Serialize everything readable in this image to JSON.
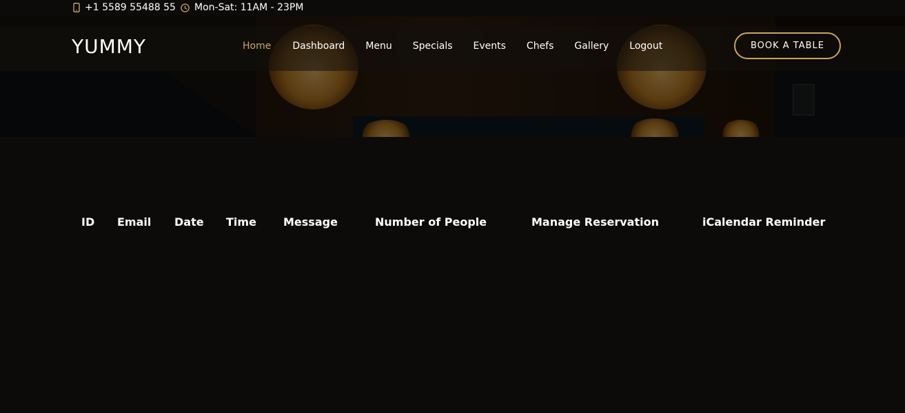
{
  "topbar": {
    "phone": "+1 5589 55488 55",
    "hours": "Mon-Sat: 11AM - 23PM",
    "icons": [
      "phone-icon",
      "clock-icon"
    ],
    "icon_color": "#cda45e"
  },
  "header": {
    "logo": "YUMMY",
    "nav": [
      {
        "label": "Home",
        "active": true
      },
      {
        "label": "Dashboard",
        "active": false
      },
      {
        "label": "Menu",
        "active": false
      },
      {
        "label": "Specials",
        "active": false
      },
      {
        "label": "Events",
        "active": false
      },
      {
        "label": "Chefs",
        "active": false
      },
      {
        "label": "Gallery",
        "active": false
      },
      {
        "label": "Logout",
        "active": false
      }
    ],
    "book_button": "BOOK A TABLE",
    "accent_color": "#cda45e"
  },
  "table": {
    "columns": [
      "ID",
      "Email",
      "Date",
      "Time",
      "Message",
      "Number of People",
      "Manage Reservation",
      "iCalendar Reminder"
    ],
    "rows": []
  }
}
